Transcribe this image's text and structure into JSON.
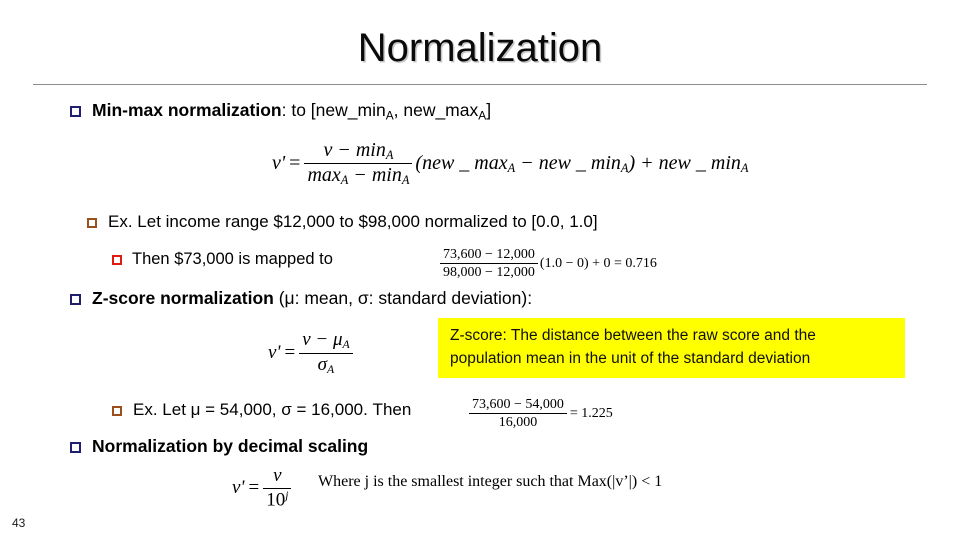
{
  "slide": {
    "title": "Normalization",
    "page_number": "43"
  },
  "bullets": {
    "minmax": {
      "label_bold": "Min-max normalization",
      "label_rest": ": to [new_min",
      "sub_a1": "A",
      "label_rest2": ", new_max",
      "sub_a2": "A",
      "label_rest3": "]"
    },
    "example_minmax": "Ex.  Let income range $12,000 to $98,000 normalized to [0.0, 1.0]",
    "mapped": "Then $73,000 is mapped to",
    "zscore": {
      "label_bold": "Z-score normalization",
      "label_rest": " (μ: mean, σ: standard deviation):"
    },
    "example_zscore": "Ex. Let μ = 54,000, σ = 16,000.  Then",
    "decimal_scaling": "Normalization by decimal scaling",
    "decimal_note": "Where j is the smallest integer such that Max(|v’|) < 1"
  },
  "callout": {
    "line1": "Z-score: The distance between the raw score and the",
    "line2": "population mean in the unit of the standard deviation",
    "background": "#ffff00"
  },
  "formulas": {
    "minmax": {
      "lhs": "v'",
      "eq": "=",
      "num": "v − min",
      "num_sub": "A",
      "den": "max",
      "den_sub1": "A",
      "den_mid": " − min",
      "den_sub2": "A",
      "tail_open": "(new _ max",
      "tail_sub1": "A",
      "tail_mid": " − new _ min",
      "tail_sub2": "A",
      "tail_close": ") + new _ min",
      "tail_sub3": "A"
    },
    "mapped_calc": {
      "num": "73,600 − 12,000",
      "den": "98,000 − 12,000",
      "tail": "(1.0 − 0) + 0 = 0.716"
    },
    "zscore": {
      "lhs": "v'",
      "eq": "=",
      "num": "v − μ",
      "num_sub": "A",
      "den": "σ",
      "den_sub": "A"
    },
    "zscore_calc": {
      "num": "73,600 − 54,000",
      "den": "16,000",
      "tail": "= 1.225"
    },
    "decimal": {
      "lhs": "v'",
      "eq": "=",
      "num": "v",
      "den": "10",
      "den_sup": "j"
    }
  },
  "colors": {
    "bullet_level1": "#1f1f6e",
    "bullet_level2": "#9b4f1d",
    "bullet_level3": "#e01b14",
    "highlight": "#ffff00",
    "rule": "#8d8d8d"
  }
}
